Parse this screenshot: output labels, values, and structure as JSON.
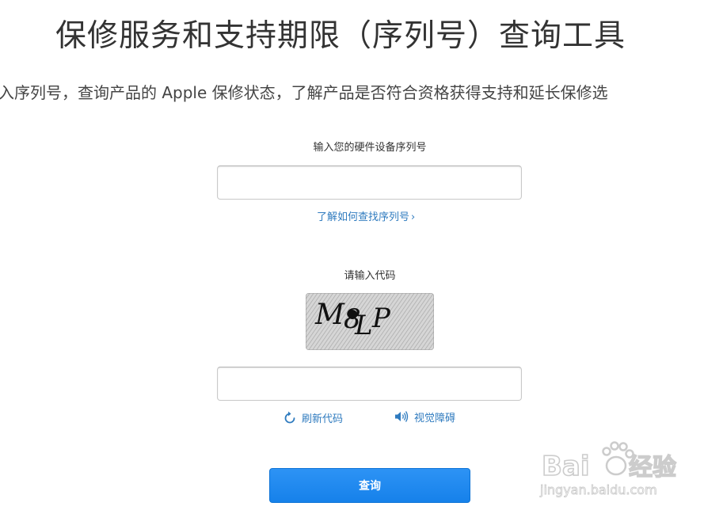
{
  "page": {
    "title": "保修服务和支持期限（序列号）查询工具",
    "subtitle": "入序列号，查询产品的 Apple 保修状态，了解产品是否符合资格获得支持和延长保修选"
  },
  "serial": {
    "label": "输入您的硬件设备序列号",
    "value": "",
    "help_link": "了解如何查找序列号",
    "help_chevron": "›"
  },
  "captcha": {
    "label": "请输入代码",
    "image_text": "M8LP",
    "value": "",
    "refresh_label": "刷新代码",
    "audio_label": "视觉障碍"
  },
  "submit": {
    "label": "查询"
  },
  "watermark": {
    "brand_text": "Bai  经验",
    "url_text": "jingyan.baidu.com"
  },
  "colors": {
    "link": "#2f7bbf",
    "button": "#1681ea",
    "title": "#333333"
  },
  "icons": {
    "refresh": "refresh-icon",
    "audio": "speaker-icon",
    "chevron": "chevron-right-icon"
  }
}
